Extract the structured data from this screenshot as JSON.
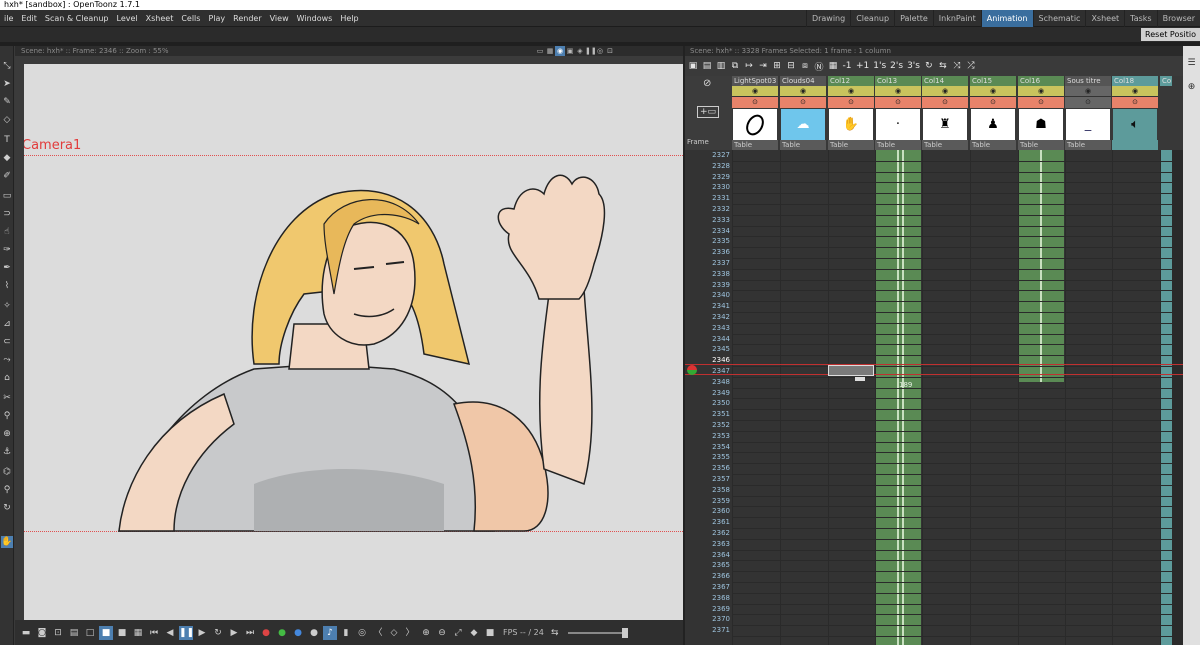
{
  "window": {
    "title": "hxh* [sandbox] : OpenToonz 1.7.1"
  },
  "menu": {
    "items": [
      "ile",
      "Edit",
      "Scan & Cleanup",
      "Level",
      "Xsheet",
      "Cells",
      "Play",
      "Render",
      "View",
      "Windows",
      "Help"
    ]
  },
  "rooms": {
    "items": [
      "Drawing",
      "Cleanup",
      "Palette",
      "InknPaint",
      "Animation",
      "Schematic",
      "Xsheet",
      "Tasks",
      "Browser"
    ],
    "active": "Animation"
  },
  "row2": {
    "reset_label": "Reset Positio"
  },
  "viewer": {
    "header": "Scene: hxh* :: Frame: 2346 :: Zoom : 55%",
    "camera_label": "Camera1",
    "fps_label": "FPS -- / 24",
    "status": "2346"
  },
  "xsheet": {
    "header": "Scene: hxh* :: 3328 Frames  Selected: 1 frame : 1 column",
    "frame_label": "Frame",
    "tool_labels": [
      "-1",
      "+1",
      "1's",
      "2's",
      "3's"
    ],
    "columns": [
      {
        "name": "LightSpot03",
        "peg": "Table",
        "thumb": "oval"
      },
      {
        "name": "Clouds04",
        "peg": "Table",
        "thumb": "clouds"
      },
      {
        "name": "Col12",
        "peg": "Table",
        "thumb": "hand"
      },
      {
        "name": "Col13",
        "peg": "Table",
        "thumb": "dot"
      },
      {
        "name": "Col14",
        "peg": "Table",
        "thumb": "figure"
      },
      {
        "name": "Col15",
        "peg": "Table",
        "thumb": "figure2"
      },
      {
        "name": "Col16",
        "peg": "Table",
        "thumb": "hair"
      },
      {
        "name": "Sous titre",
        "peg": "Table",
        "thumb": "line"
      },
      {
        "name": "Col18",
        "peg": "",
        "thumb": "speaker"
      },
      {
        "name": "Co",
        "peg": "",
        "thumb": ""
      }
    ],
    "frames": [
      "2327",
      "2328",
      "2329",
      "2330",
      "2331",
      "2332",
      "2333",
      "2334",
      "2335",
      "2336",
      "2337",
      "2338",
      "2339",
      "2340",
      "2341",
      "2342",
      "2343",
      "2344",
      "2345",
      "2346",
      "2347",
      "2348",
      "2349",
      "2350",
      "2351",
      "2352",
      "2353",
      "2354",
      "2355",
      "2356",
      "2357",
      "2358",
      "2359",
      "2360",
      "2361",
      "2362",
      "2363",
      "2364",
      "2365",
      "2366",
      "2367",
      "2368",
      "2369",
      "2370",
      "2371"
    ],
    "current_frame": "2346",
    "cell_label": "189"
  },
  "colors": {
    "accent": "#4d7fb0",
    "timeline_green": "#5a8a54",
    "camera_red": "#e23b3b"
  }
}
